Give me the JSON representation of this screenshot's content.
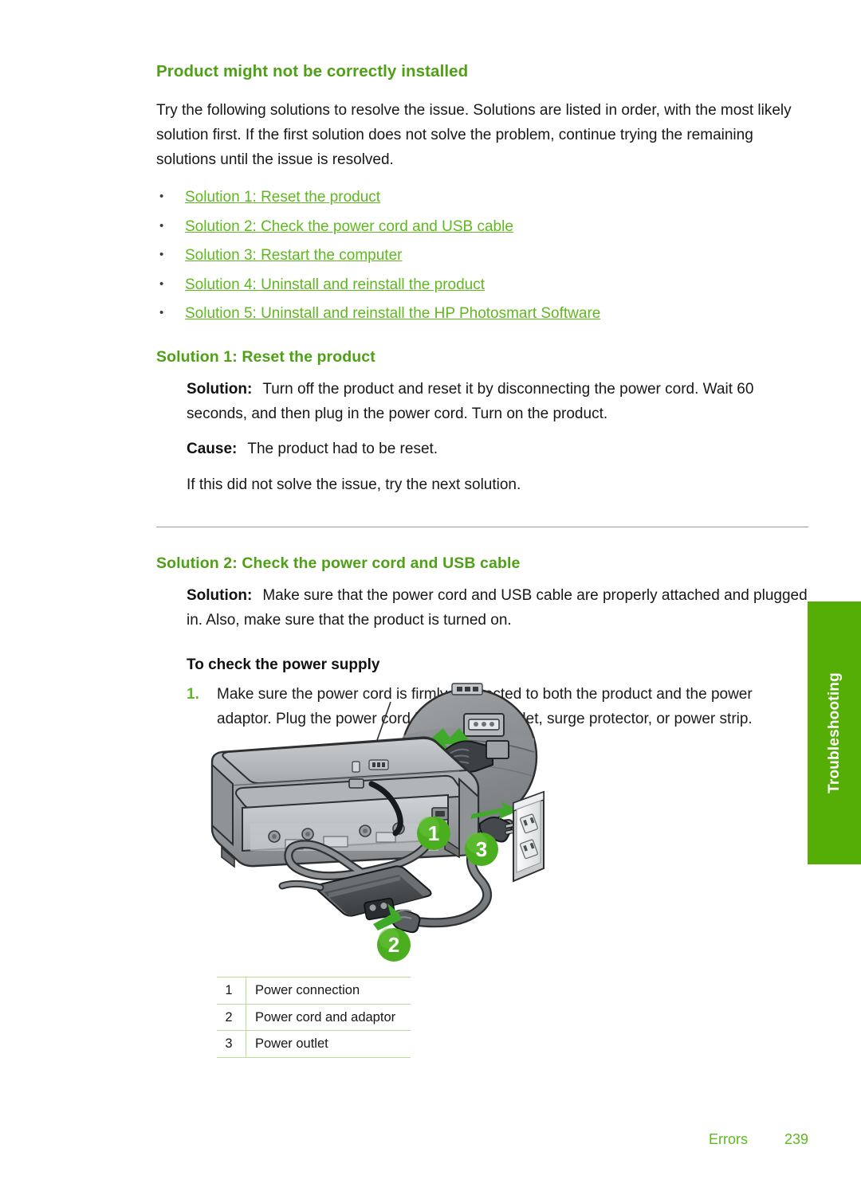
{
  "page": {
    "section_title": "Product might not be correctly installed",
    "intro": "Try the following solutions to resolve the issue. Solutions are listed in order, with the most likely solution first. If the first solution does not solve the problem, continue trying the remaining solutions until the issue is resolved.",
    "bullet_glyph": "•"
  },
  "solution_links": [
    {
      "label": "Solution 1: Reset the product"
    },
    {
      "label": "Solution 2: Check the power cord and USB cable"
    },
    {
      "label": "Solution 3: Restart the computer"
    },
    {
      "label": "Solution 4: Uninstall and reinstall the product"
    },
    {
      "label": "Solution 5: Uninstall and reinstall the HP Photosmart Software"
    }
  ],
  "solution1": {
    "title": "Solution 1: Reset the product",
    "solution_label": "Solution:",
    "solution_text": "Turn off the product and reset it by disconnecting the power cord. Wait 60 seconds, and then plug in the power cord. Turn on the product.",
    "cause_label": "Cause:",
    "cause_text": "The product had to be reset.",
    "next": "If this did not solve the issue, try the next solution."
  },
  "solution2": {
    "title": "Solution 2: Check the power cord and USB cable",
    "solution_label": "Solution:",
    "solution_text": "Make sure that the power cord and USB cable are properly attached and plugged in. Also, make sure that the product is turned on.",
    "procedure_title": "To check the power supply",
    "steps": [
      {
        "num": "1.",
        "text": "Make sure the power cord is firmly connected to both the product and the power adaptor. Plug the power cord into a power outlet, surge protector, or power strip."
      }
    ]
  },
  "figure": {
    "callouts": [
      "1",
      "2",
      "3"
    ],
    "legend": [
      {
        "key": "1",
        "value": "Power connection"
      },
      {
        "key": "2",
        "value": "Power cord and adaptor"
      },
      {
        "key": "3",
        "value": "Power outlet"
      }
    ]
  },
  "side_tab": {
    "label": "Troubleshooting"
  },
  "footer": {
    "label": "Errors",
    "page_number": "239"
  },
  "colors": {
    "heading_green": "#4ea014",
    "link_green": "#5fb81f",
    "tab_green": "#54ae05",
    "callout_green": "#4aae1e",
    "rule_gray": "#9a9a9a",
    "table_rule": "#b7dd93"
  }
}
